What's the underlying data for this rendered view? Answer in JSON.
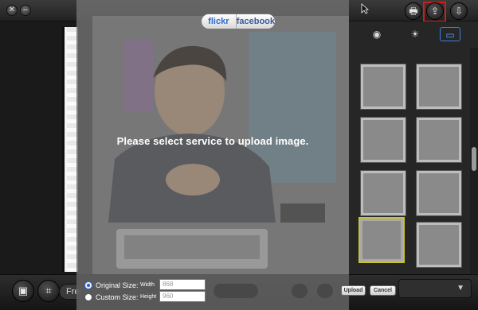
{
  "window": {
    "buttons": [
      {
        "glyph": "✕"
      },
      {
        "glyph": "–"
      }
    ],
    "toolbar_right": [
      {
        "icon": "print-icon",
        "glyph": "🖶"
      },
      {
        "icon": "share-icon",
        "glyph": "⇪"
      },
      {
        "icon": "download-icon",
        "glyph": "⇩"
      }
    ]
  },
  "side_tabs": [
    {
      "icon": "camera-icon",
      "glyph": "◉"
    },
    {
      "icon": "brightness-icon",
      "glyph": "☀"
    },
    {
      "icon": "frame-icon",
      "glyph": "▭"
    }
  ],
  "upload_dialog": {
    "services": [
      {
        "label": "flickr",
        "selected": true
      },
      {
        "label": "facebook",
        "selected": false
      }
    ],
    "message": "Please select service to upload image.",
    "size_options": {
      "original": {
        "label": "Original Size:",
        "checked": true
      },
      "custom": {
        "label": "Custom Size:",
        "checked": false
      }
    },
    "width": {
      "label": "Width",
      "value": "868"
    },
    "height": {
      "label": "Height",
      "value": "960"
    },
    "upload_label": "Upload",
    "cancel_label": "Cancel"
  },
  "bottom_bar": {
    "crop_pill_label": "Fre"
  },
  "colors": {
    "accent_highlight": "#c8201a",
    "selected_thumb": "#c9c32a",
    "flickr_text": "#2a6bd6",
    "facebook_text": "#3b5998"
  }
}
